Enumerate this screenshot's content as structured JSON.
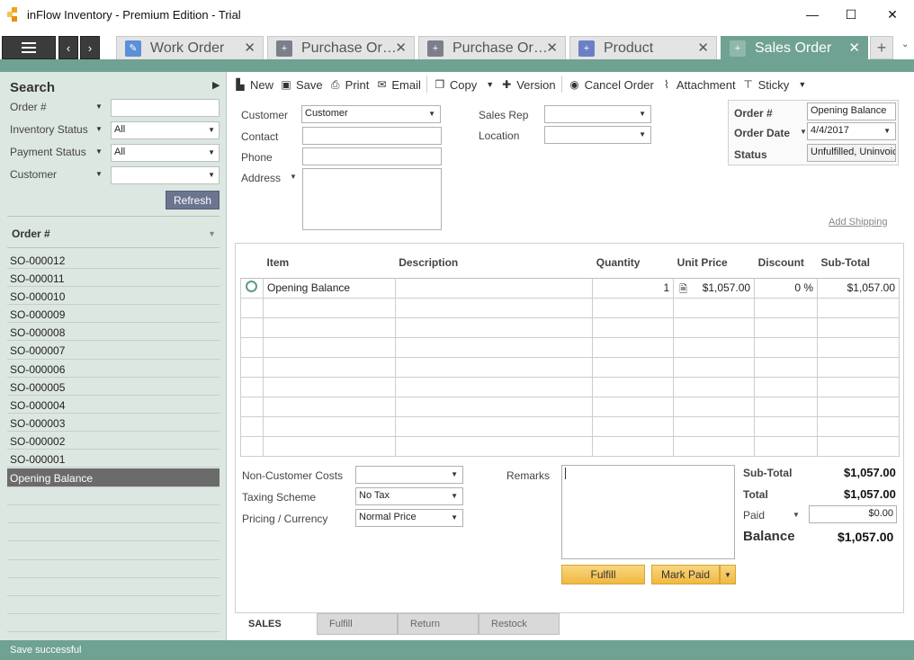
{
  "window": {
    "title": "inFlow Inventory - Premium Edition - Trial",
    "controls": [
      "minimize",
      "maximize",
      "close"
    ]
  },
  "tabs": [
    {
      "label": "Work Order",
      "icon": "work-order-icon",
      "color": "#5b8fd6"
    },
    {
      "label": "Purchase Or…",
      "icon": "purchase-order-icon",
      "color": "#7b7f8a"
    },
    {
      "label": "Purchase Or…",
      "icon": "purchase-order-icon",
      "color": "#7b7f8a"
    },
    {
      "label": "Product",
      "icon": "product-icon",
      "color": "#6b80c4"
    },
    {
      "label": "Sales Order",
      "icon": "sales-order-icon",
      "color": "#8fb8aa",
      "active": true
    }
  ],
  "search": {
    "title": "Search",
    "filters": [
      {
        "label": "Order #",
        "value": ""
      },
      {
        "label": "Inventory Status",
        "value": "All"
      },
      {
        "label": "Payment Status",
        "value": "All"
      },
      {
        "label": "Customer",
        "value": ""
      }
    ],
    "refresh_label": "Refresh",
    "list_header": "Order #",
    "orders": [
      "SO-000012",
      "SO-000011",
      "SO-000010",
      "SO-000009",
      "SO-000008",
      "SO-000007",
      "SO-000006",
      "SO-000005",
      "SO-000004",
      "SO-000003",
      "SO-000002",
      "SO-000001"
    ],
    "selected_order": "Opening Balance"
  },
  "toolbar": {
    "new": "New",
    "save": "Save",
    "print": "Print",
    "email": "Email",
    "copy": "Copy",
    "version": "Version",
    "cancel_order": "Cancel Order",
    "attachment": "Attachment",
    "sticky": "Sticky"
  },
  "form": {
    "customer_label": "Customer",
    "customer_value": "Customer",
    "contact_label": "Contact",
    "contact_value": "",
    "phone_label": "Phone",
    "phone_value": "",
    "address_label": "Address",
    "address_value": "",
    "salesrep_label": "Sales Rep",
    "salesrep_value": "",
    "location_label": "Location",
    "location_value": "",
    "order_no_label": "Order #",
    "order_no_value": "Opening Balance",
    "order_date_label": "Order Date",
    "order_date_value": "4/4/2017",
    "status_label": "Status",
    "status_value": "Unfulfilled, Uninvoic",
    "add_shipping": "Add Shipping"
  },
  "grid": {
    "columns": [
      "Item",
      "Description",
      "Quantity",
      "Unit Price",
      "Discount",
      "Sub-Total"
    ],
    "rows": [
      {
        "item": "Opening Balance",
        "description": "",
        "quantity": "1",
        "unit_price": "$1,057.00",
        "discount": "0 %",
        "subtotal": "$1,057.00"
      }
    ]
  },
  "footer": {
    "noncustomer_label": "Non-Customer Costs",
    "noncustomer_value": "",
    "taxing_label": "Taxing Scheme",
    "taxing_value": "No Tax",
    "pricing_label": "Pricing / Currency",
    "pricing_value": "Normal Price",
    "remarks_label": "Remarks",
    "remarks_value": "",
    "subtotal_label": "Sub-Total",
    "subtotal_value": "$1,057.00",
    "total_label": "Total",
    "total_value": "$1,057.00",
    "paid_label": "Paid",
    "paid_value": "$0.00",
    "balance_label": "Balance",
    "balance_value": "$1,057.00",
    "fulfill_label": "Fulfill",
    "markpaid_label": "Mark Paid"
  },
  "bottom_tabs": [
    "SALES",
    "Fulfill",
    "Return",
    "Restock"
  ],
  "status": "Save successful",
  "colors": {
    "accent": "#6fa292",
    "selected": "#6b6b6b",
    "button": "#f0b841"
  }
}
